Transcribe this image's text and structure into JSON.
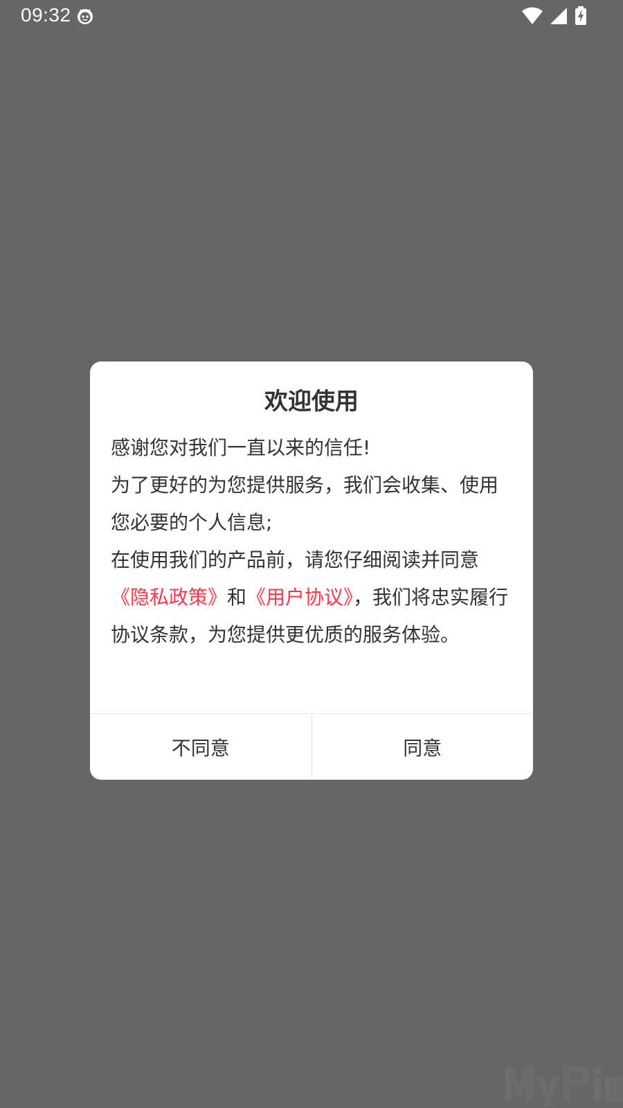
{
  "status_bar": {
    "time": "09:32",
    "icons": [
      "cat-notification-icon",
      "wifi-icon",
      "cell-signal-icon",
      "battery-charging-icon"
    ]
  },
  "dialog": {
    "title": "欢迎使用",
    "line1": "感谢您对我们一直以来的信任!",
    "line2": "为了更好的为您提供服务，我们会收集、使用您必要的个人信息;",
    "line3_prefix": "在使用我们的产品前，请您仔细阅读并同意",
    "privacy_link": "《隐私政策》",
    "and_text": "和",
    "agreement_link": "《用户协议》",
    "line3_suffix": "，我们将忠实履行协议条款，为您提供更优质的服务体验。",
    "disagree_label": "不同意",
    "agree_label": "同意",
    "link_color": "#f23a4a"
  },
  "background_color": "#666666"
}
